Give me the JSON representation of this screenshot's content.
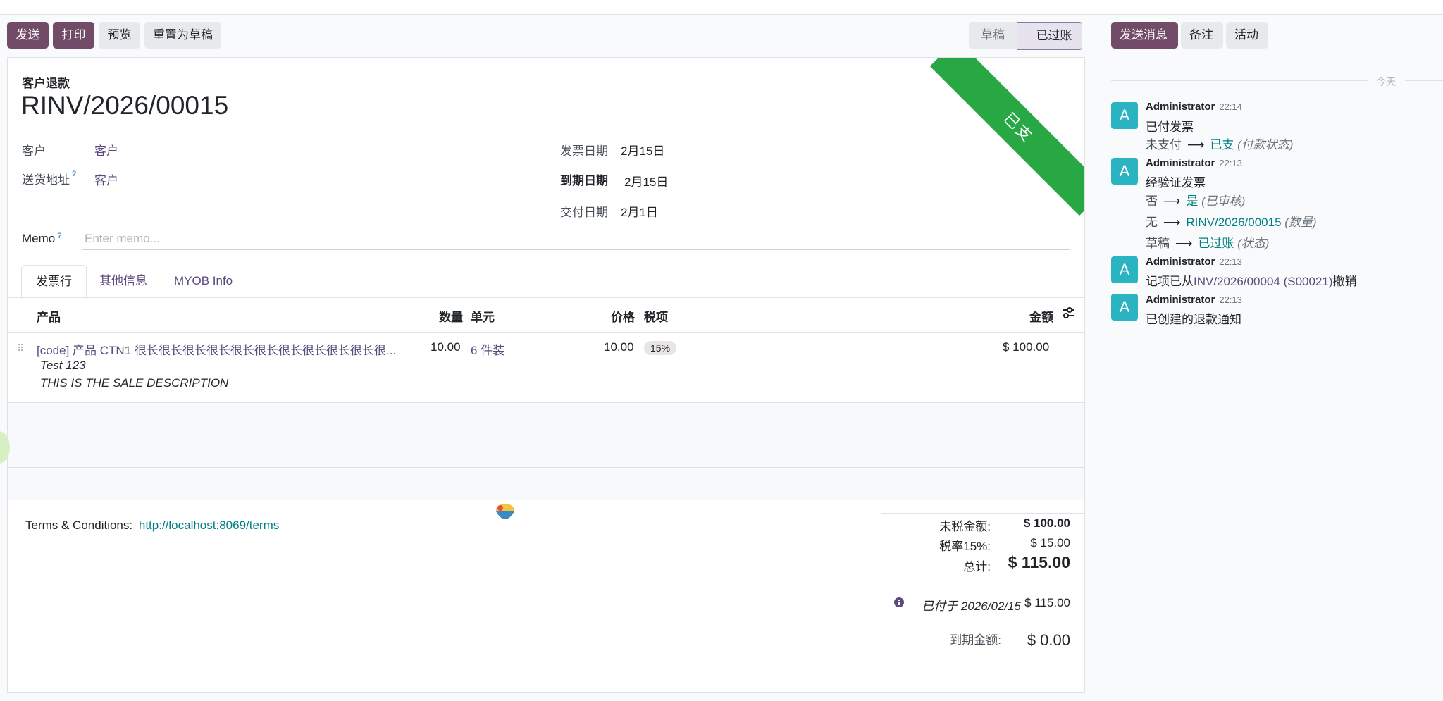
{
  "toolbar": {
    "send": "发送",
    "print": "打印",
    "preview": "预览",
    "reset_draft": "重置为草稿"
  },
  "status": {
    "draft": "草稿",
    "posted": "已过账"
  },
  "ribbon": "已支",
  "doc": {
    "type": "客户退款",
    "number": "RINV/2026/00015"
  },
  "fields": {
    "customer_label": "客户",
    "customer_value": "客户",
    "delivery_label": "送货地址",
    "delivery_help": "?",
    "delivery_value": "客户",
    "invoice_date_label": "发票日期",
    "invoice_date_value": "2月15日",
    "due_date_label": "到期日期",
    "due_date_value": "2月15日",
    "delivery_date_label": "交付日期",
    "delivery_date_value": "2月1日",
    "memo_label": "Memo",
    "memo_help": "?",
    "memo_placeholder": "Enter memo..."
  },
  "tabs": [
    "发票行",
    "其他信息",
    "MYOB Info"
  ],
  "table": {
    "headers": {
      "product": "产品",
      "qty": "数量",
      "uom": "单元",
      "price": "价格",
      "tax": "税项",
      "amount": "金额"
    },
    "rows": [
      {
        "product": "[code] 产品 CTN1 很长很长很长很长很长很长很长很长很长很长很...",
        "desc1": "Test 123",
        "desc2": "THIS IS THE SALE DESCRIPTION",
        "qty": "10.00",
        "uom": "6 件装",
        "price": "10.00",
        "tax": "15%",
        "amount": "$ 100.00"
      }
    ]
  },
  "terms": {
    "label": "Terms & Conditions:",
    "link": "http://localhost:8069/terms"
  },
  "totals": {
    "untaxed_label": "未税金额:",
    "untaxed_value": "$ 100.00",
    "tax_label": "税率15%:",
    "tax_value": "$ 15.00",
    "total_label": "总计:",
    "total_value": "$ 115.00",
    "paid_label": "已付于 2026/02/15",
    "paid_value": "$ 115.00",
    "due_label": "到期金额:",
    "due_value": "$ 0.00"
  },
  "chatter": {
    "send_message": "发送消息",
    "log_note": "备注",
    "activities": "活动",
    "today": "今天",
    "messages": [
      {
        "author": "Administrator",
        "time": "22:14",
        "body": "已付发票",
        "tracking": [
          {
            "old": "未支付",
            "new": "已支",
            "field": "(付款状态)"
          }
        ]
      },
      {
        "author": "Administrator",
        "time": "22:13",
        "body": "经验证发票",
        "tracking": [
          {
            "old": "否",
            "new": "是",
            "field": "(已审核)"
          },
          {
            "old": "无",
            "new": "RINV/2026/00015",
            "field": "(数量)"
          },
          {
            "old": "草稿",
            "new": "已过账",
            "field": "(状态)"
          }
        ]
      },
      {
        "author": "Administrator",
        "time": "22:13",
        "body_prefix": "记项已从",
        "body_link": "INV/2026/00004 (S00021)",
        "body_suffix": "撤销"
      },
      {
        "author": "Administrator",
        "time": "22:13",
        "body": "已创建的退款通知"
      }
    ]
  }
}
